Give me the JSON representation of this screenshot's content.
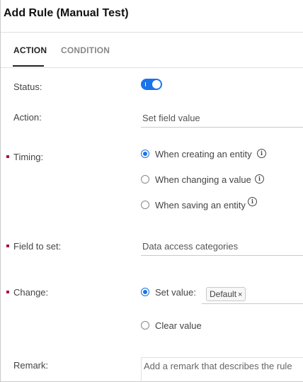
{
  "dialog": {
    "title": "Add Rule (Manual Test)"
  },
  "tabs": [
    {
      "label": "ACTION",
      "active": true
    },
    {
      "label": "CONDITION",
      "active": false
    }
  ],
  "form": {
    "status": {
      "label": "Status:",
      "enabled": true,
      "toggle_glyph": "I"
    },
    "action": {
      "label": "Action:",
      "value": "Set field value"
    },
    "timing": {
      "label": "Timing:",
      "required": true,
      "options": [
        {
          "label": "When creating an entity",
          "selected": true,
          "info_icon": "info-icon"
        },
        {
          "label": "When changing a value",
          "selected": false,
          "info_icon": "info-icon"
        },
        {
          "label": "When saving an entity",
          "selected": false,
          "info_icon": "info-icon"
        }
      ]
    },
    "field_to_set": {
      "label": "Field to set:",
      "required": true,
      "value": "Data access categories"
    },
    "change": {
      "label": "Change:",
      "required": true,
      "set_value": {
        "label": "Set value:",
        "selected": true,
        "chip": "Default",
        "chip_remove": "×"
      },
      "clear_value": {
        "label": "Clear value",
        "selected": false
      }
    },
    "remark": {
      "label": "Remark:",
      "placeholder": "Add a remark that describes the rule"
    }
  },
  "colors": {
    "accent": "#1a73e8",
    "required_marker": "#a0164d"
  },
  "info_glyph": "i"
}
